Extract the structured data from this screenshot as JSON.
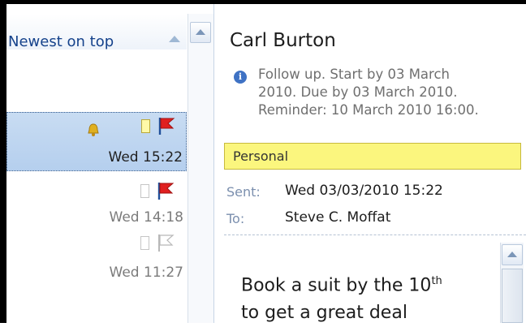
{
  "list": {
    "sort_label": "Newest on top",
    "rows": [
      {
        "time": "Wed 15:22",
        "selected": true,
        "category_color": "#fff9a8",
        "flag": "red",
        "reminder": true
      },
      {
        "time": "Wed 14:18",
        "selected": false,
        "category_color": "none",
        "flag": "red",
        "reminder": false
      },
      {
        "time": "Wed 11:27",
        "selected": false,
        "category_color": "none",
        "flag": "outline",
        "reminder": false
      }
    ]
  },
  "message": {
    "sender": "Carl Burton",
    "followup_lines": [
      "Follow up.  Start by 03 March",
      "2010.  Due by 03 March 2010.",
      "Reminder: 10 March 2010 16:00."
    ],
    "category": "Personal",
    "sent_label": "Sent:",
    "sent_value": "Wed 03/03/2010 15:22",
    "to_label": "To:",
    "to_value": "Steve C. Moffat",
    "body_line1": "Book a suit by the 10",
    "body_line1_sup": "th",
    "body_line2": "to get a great deal"
  },
  "icons": {
    "info": "info-icon",
    "reminder": "bell-icon",
    "flag_red": "flag-icon",
    "flag_outline": "flag-outline-icon"
  },
  "colors": {
    "selection": "#c8dcf2",
    "category_yellow": "#fbf67e",
    "flag_red": "#e02020",
    "info_blue": "#3f72c4"
  }
}
